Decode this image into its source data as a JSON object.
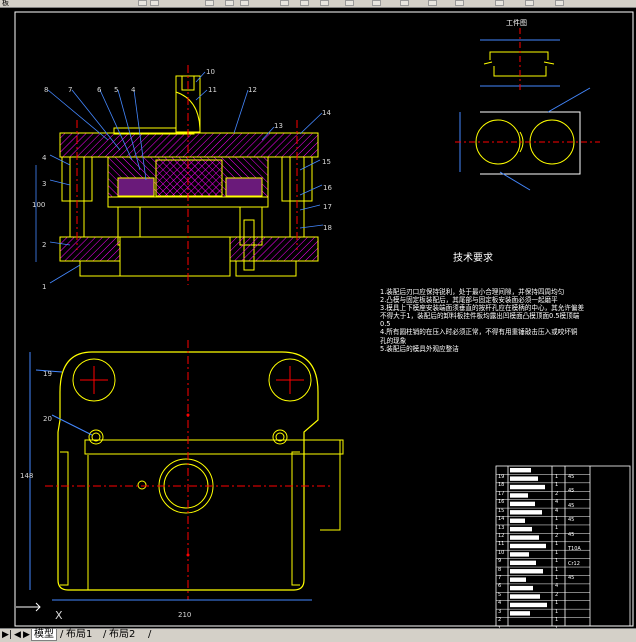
{
  "app": {
    "toolbar_fragment": "板"
  },
  "drawing": {
    "tech_requirements": {
      "title": "技术要求",
      "lines": [
        "1.装配后刃口应保持锐利，处于最小合理间隙，并保持四周均匀",
        "2.凸模与固定板装配后，其尾部与固定板安装面必须一起磨平",
        "3.模具上下模座安装端面须垂直的按杆孔应在模柄的中心，其允许偏差",
        "不得大于1，装配后的卸料板挂件板均露出凹模面凸模顶面0.5模顶端",
        "0.5",
        "4.所有圆柱销的在压入时必须正常，不得有用重锤敲击压入或咬坏铜",
        "孔的现象",
        "5.装配后的模具外观应整洁"
      ]
    },
    "part_view": {
      "title": "工件图"
    },
    "callouts": {
      "top": [
        "10",
        "11",
        "12",
        "13",
        "14",
        "15",
        "16",
        "17",
        "18",
        "8",
        "7",
        "6",
        "5",
        "4",
        "3",
        "2",
        "1",
        "9",
        "100"
      ],
      "plan": [
        "19",
        "20",
        "148",
        "210"
      ]
    },
    "title_block": {
      "row_numbers": [
        "19",
        "18",
        "17",
        "16",
        "15",
        "14",
        "13",
        "12",
        "11",
        "10",
        "9",
        "8",
        "7",
        "6",
        "5",
        "4",
        "3",
        "2",
        "1"
      ],
      "qty": [
        "1",
        "1",
        "2",
        "4",
        "4",
        "1",
        "1",
        "2",
        "1",
        "1",
        "1",
        "1",
        "1",
        "4",
        "2",
        "1",
        "1",
        "1",
        "1"
      ],
      "notes": [
        "45",
        "45",
        "45",
        "45",
        "45",
        "T10A",
        "Cr12",
        "45"
      ]
    },
    "ucs": {
      "label": "X"
    }
  },
  "tabs": {
    "model": "模型",
    "layout1": "布局1",
    "layout2": "布局2"
  },
  "colors": {
    "line": "#ffff00",
    "hatch": "#ff00ff",
    "dim": "#4488ff",
    "leader": "#ffffff",
    "center": "#ff0000",
    "background": "#000000"
  }
}
